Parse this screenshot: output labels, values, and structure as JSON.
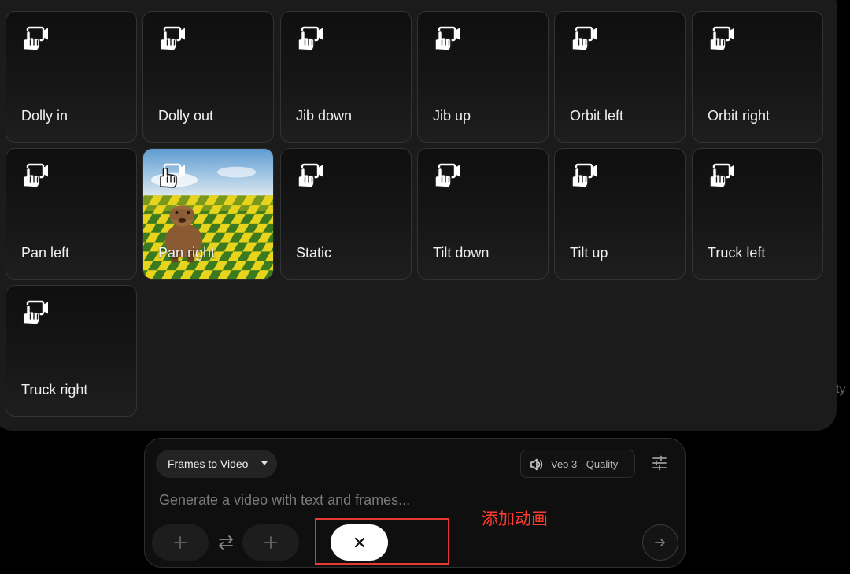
{
  "motions": [
    {
      "label": "Dolly in"
    },
    {
      "label": "Dolly out"
    },
    {
      "label": "Jib down"
    },
    {
      "label": "Jib up"
    },
    {
      "label": "Orbit left"
    },
    {
      "label": "Orbit right"
    },
    {
      "label": "Pan left"
    },
    {
      "label": "Pan right"
    },
    {
      "label": "Static"
    },
    {
      "label": "Tilt down"
    },
    {
      "label": "Tilt up"
    },
    {
      "label": "Truck left"
    },
    {
      "label": "Truck right"
    }
  ],
  "background_hint": "ty",
  "composer": {
    "mode_label": "Frames to Video",
    "model_label": "Veo 3 - Quality",
    "prompt_placeholder": "Generate a video with text and frames..."
  },
  "annotation": {
    "text": "添加动画",
    "color": "#ff3b30"
  },
  "icons": {
    "card": "hand-camera-icon",
    "mode": "caret-down-icon",
    "model": "speaker-icon",
    "settings": "sliders-icon",
    "swap": "swap-arrows-icon",
    "add": "plus-icon",
    "close": "close-icon",
    "send": "arrow-right-icon"
  }
}
